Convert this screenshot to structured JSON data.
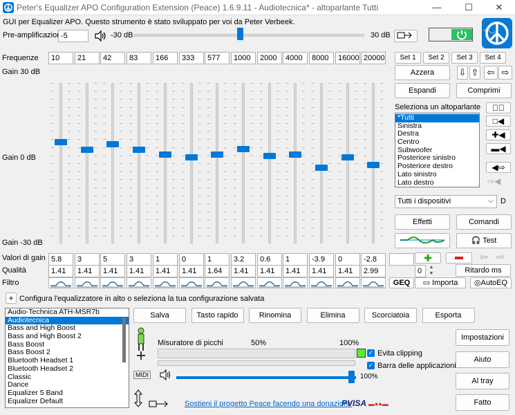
{
  "window": {
    "title": "Peter's Equalizer APO Configuration Extension (Peace) 1.6.9.11 - Audiotecnica* - altoparlante Tutti",
    "minimize": "—",
    "maximize": "☐",
    "close": "✕"
  },
  "subtitle": "GUI per Equalizer APO. Questo strumento è stato sviluppato per voi da Peter Verbeek.",
  "preamp": {
    "label": "Pre-amplificazione",
    "value": "-5",
    "min_label": "-30 dB",
    "max_label": "30 dB",
    "level": 0.46
  },
  "labels": {
    "frequencies": "Frequenze",
    "gain_top": "Gain 30 dB",
    "gain_mid": "Gain 0 dB",
    "gain_bottom": "Gain -30 dB",
    "gain_values": "Valori di gain",
    "quality": "Qualità",
    "filter": "Filtro"
  },
  "frequencies": [
    "10",
    "21",
    "42",
    "83",
    "166",
    "333",
    "577",
    "1000",
    "2000",
    "4000",
    "8000",
    "16000",
    "20000"
  ],
  "gains": [
    "5.8",
    "3",
    "5",
    "3",
    "1",
    "0",
    "1",
    "3.2",
    "0.6",
    "1",
    "-3.9",
    "0",
    "-2.8"
  ],
  "gain_levels": [
    5.8,
    3,
    5,
    3,
    1,
    0,
    1,
    3.2,
    0.6,
    1,
    -3.9,
    0,
    -2.8
  ],
  "qualities": [
    "1.41",
    "1.41",
    "1.41",
    "1.41",
    "1.41",
    "1.41",
    "1.64",
    "1.41",
    "1.41",
    "1.41",
    "1.41",
    "1.41",
    "2.99"
  ],
  "sets": [
    "Set 1",
    "Set 2",
    "Set 3",
    "Set 4"
  ],
  "buttons": {
    "reset": "Azzera",
    "expand": "Espandi",
    "compress": "Comprimi",
    "effects": "Effetti",
    "commands": "Comandi",
    "test": "Test",
    "import": "Importa",
    "autoeq": "AutoEQ",
    "geq": "GEQ",
    "ritardo": "Ritardo ms",
    "ritardo_value": "0"
  },
  "speakers": {
    "label": "Seleziona un altoparlante",
    "items": [
      "*Tutti",
      "Sinistra",
      "Destra",
      "Centro",
      "Subwoofer",
      "Posteriore sinistro",
      "Posteriore destro",
      "Lato sinistro",
      "Lato destro"
    ]
  },
  "device": {
    "value": "Tutti i dispositivi",
    "extra": "D"
  },
  "config": {
    "hint": "Configura l'equalizzatore in alto o seleziona la tua configurazione salvata",
    "plus": "+",
    "items": [
      "Audio-Technica ATH-MSR7b",
      "Audiotecnica",
      "Bass and High Boost",
      "Bass and High Boost 2",
      "Bass Boost",
      "Bass Boost 2",
      "Bluetooth Headset 1",
      "Bluetooth Headset 2",
      "Classic",
      "Dance",
      "Equalizer 5 Band",
      "Equalizer Default"
    ],
    "selected": 1
  },
  "actions": [
    "Salva",
    "Tasto rapido",
    "Rinomina",
    "Elimina",
    "Scorciatoia",
    "Esporta"
  ],
  "side": [
    "Impostazioni",
    "Aiuto",
    "Al tray",
    "Fatto"
  ],
  "meter": {
    "label": "Misuratore di picchi",
    "p50": "50%",
    "p100": "100%",
    "volume": "100%"
  },
  "options": {
    "clipping": "Evita clipping",
    "taskbar": "Barra delle applicazioni"
  },
  "midi": "MIDI",
  "donate": "Sostieni il progetto Peace facendo una donazione",
  "payments": {
    "visa": "VISA"
  },
  "colors": {
    "accent": "#0078d7",
    "power": "#22c55e",
    "green": "#22a022",
    "red": "#d92020",
    "clip": "#55ee33"
  }
}
